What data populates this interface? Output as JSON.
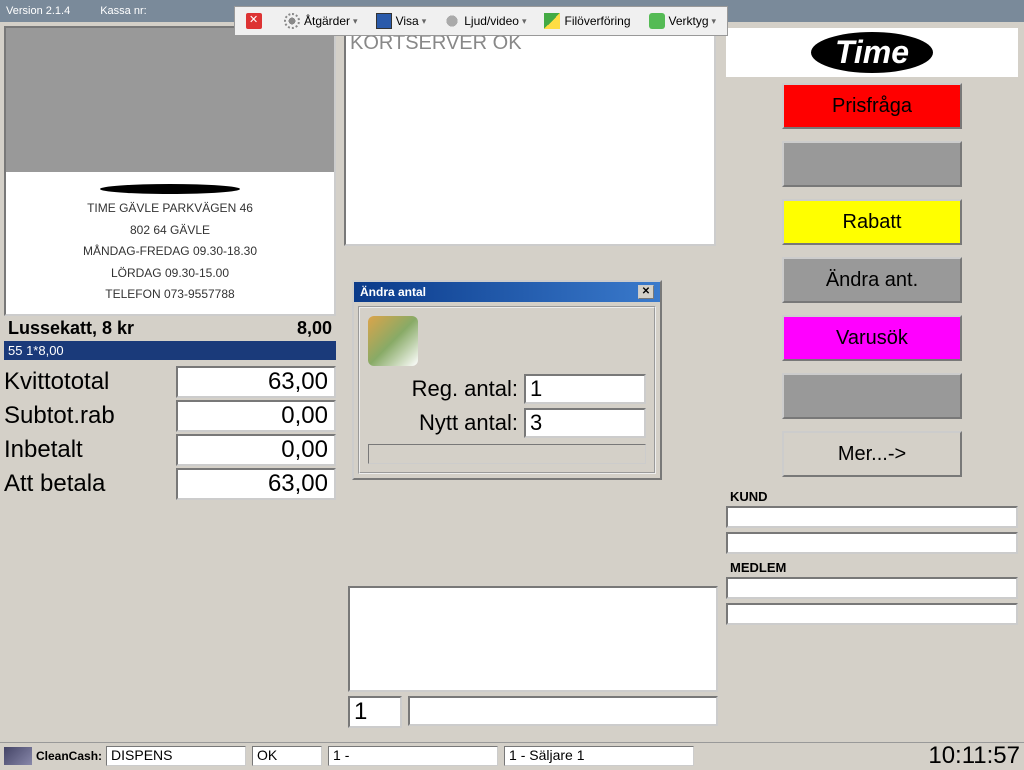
{
  "titlebar": {
    "version": "Version 2.1.4",
    "kassa": "Kassa nr:"
  },
  "toolbar": {
    "actions": "Åtgärder",
    "show": "Visa",
    "av": "Ljud/video",
    "file": "Filöverföring",
    "tools": "Verktyg"
  },
  "receipt": {
    "store": "TIME GÄVLE PARKVÄGEN 46",
    "zip": "802 64 GÄVLE",
    "hours1": "MÅNDAG-FREDAG 09.30-18.30",
    "hours2": "LÖRDAG 09.30-15.00",
    "phone": "TELEFON 073-9557788"
  },
  "item": {
    "name": "Lussekatt,  8 kr",
    "price": "8,00",
    "sub": "55 1*8,00"
  },
  "totals": {
    "kvitto_label": "Kvittototal",
    "kvitto": "63,00",
    "subtot_label": "Subtot.rab",
    "subtot": "0,00",
    "inbetalt_label": "Inbetalt",
    "inbetalt": "0,00",
    "att_label": "Att betala",
    "att": "63,00"
  },
  "kortserver": "KORTSERVER OK",
  "dialog": {
    "title": "Ändra antal",
    "reg_label": "Reg. antal:",
    "reg_val": "1",
    "nytt_label": "Nytt antal:",
    "nytt_val": "3"
  },
  "sidebuttons": {
    "pris": "Prisfråga",
    "rabatt": "Rabatt",
    "andra": "Ändra ant.",
    "varusok": "Varusök",
    "mer": "Mer...->"
  },
  "sections": {
    "kund": "KUND",
    "medlem": "MEDLEM"
  },
  "lower": {
    "one": "1"
  },
  "status": {
    "cc": "CleanCash:",
    "dispens": "DISPENS",
    "ok": "OK",
    "f1": "1 -",
    "f2": "1 - Säljare 1",
    "clock": "10:11:57"
  }
}
